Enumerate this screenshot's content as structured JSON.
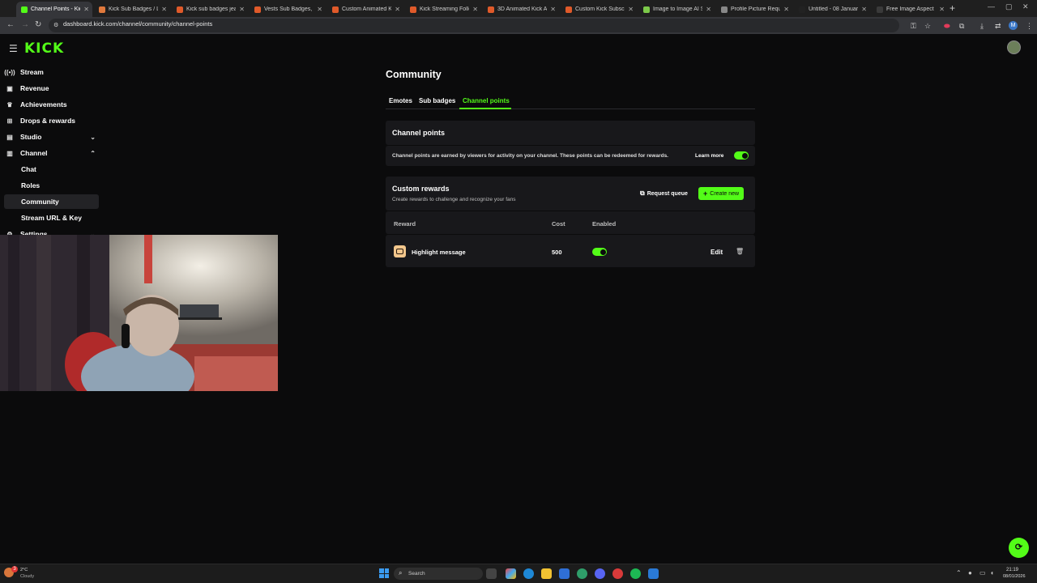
{
  "browser": {
    "tabs": [
      {
        "label": "Channel Points - Kick",
        "color": "#53fc18"
      },
      {
        "label": "Kick Sub Badges / Log",
        "color": "#e0793c"
      },
      {
        "label": "Kick sub badges jeans",
        "color": "#e05a2a"
      },
      {
        "label": "Vests Sub Badges, Em",
        "color": "#e05a2a"
      },
      {
        "label": "Custom Animated Kick",
        "color": "#e05a2a"
      },
      {
        "label": "Kick Streaming Follow",
        "color": "#e05a2a"
      },
      {
        "label": "3D Animated Kick Alo",
        "color": "#e05a2a"
      },
      {
        "label": "Custom Kick Subscrib",
        "color": "#e05a2a"
      },
      {
        "label": "Image to Image AI Sh",
        "color": "#7cc94a"
      },
      {
        "label": "Profile Picture Request",
        "color": "#888888"
      },
      {
        "label": "Untitled - 08 January",
        "color": "#222222"
      },
      {
        "label": "Free Image Aspect Ra",
        "color": "#3a3a3a"
      }
    ],
    "url": "dashboard.kick.com/channel/community/channel-points",
    "profile_letter": "M"
  },
  "brand": {
    "logo": "KICK",
    "accent": "#53fc18"
  },
  "sidebar": {
    "items": [
      {
        "label": "Stream",
        "icon": "stream-icon"
      },
      {
        "label": "Revenue",
        "icon": "revenue-icon"
      },
      {
        "label": "Achievements",
        "icon": "trophy-icon"
      },
      {
        "label": "Drops & rewards",
        "icon": "gift-icon"
      },
      {
        "label": "Studio",
        "icon": "studio-icon"
      },
      {
        "label": "Channel",
        "icon": "channel-icon"
      },
      {
        "label": "Chat"
      },
      {
        "label": "Roles"
      },
      {
        "label": "Community"
      },
      {
        "label": "Stream URL & Key"
      },
      {
        "label": "Settings",
        "icon": "settings-icon"
      }
    ]
  },
  "main": {
    "title": "Community",
    "tabs": [
      "Emotes",
      "Sub badges",
      "Channel points"
    ],
    "channel_points": {
      "heading": "Channel points",
      "description": "Channel points are earned by viewers for activity on your channel. These points can be redeemed for rewards.",
      "learn_more": "Learn more",
      "enabled": true
    },
    "custom_rewards": {
      "heading": "Custom rewards",
      "subheading": "Create rewards to challenge and recognize your fans",
      "request_queue": "Request queue",
      "create_new": "Create new",
      "columns": [
        "Reward",
        "Cost",
        "Enabled"
      ],
      "rows": [
        {
          "name": "Highlight message",
          "cost": "500",
          "enabled": true,
          "edit": "Edit"
        }
      ]
    }
  },
  "taskbar": {
    "weather_temp": "2°C",
    "weather_desc": "Cloudy",
    "search_placeholder": "Search",
    "time": "21:19",
    "date": "08/01/2026",
    "notification_count": "3"
  }
}
